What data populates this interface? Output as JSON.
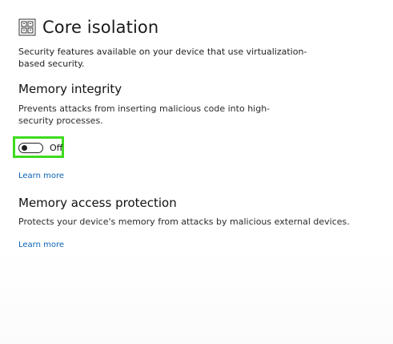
{
  "header": {
    "icon": "core-isolation-chip-icon",
    "title": "Core isolation"
  },
  "intro": {
    "text": "Security features available on your device that use virtualization-based security."
  },
  "memory_integrity": {
    "heading": "Memory integrity",
    "description": "Prevents attacks from inserting malicious code into high-security processes.",
    "toggle": {
      "state": "off",
      "label": "Off"
    },
    "highlight_color": "#3ddc1e",
    "learn_more": "Learn more"
  },
  "memory_access_protection": {
    "heading": "Memory access protection",
    "description": "Protects your device's memory from attacks by malicious external devices.",
    "learn_more": "Learn more"
  },
  "colors": {
    "link": "#0b63b6",
    "highlight": "#3ddc1e"
  }
}
